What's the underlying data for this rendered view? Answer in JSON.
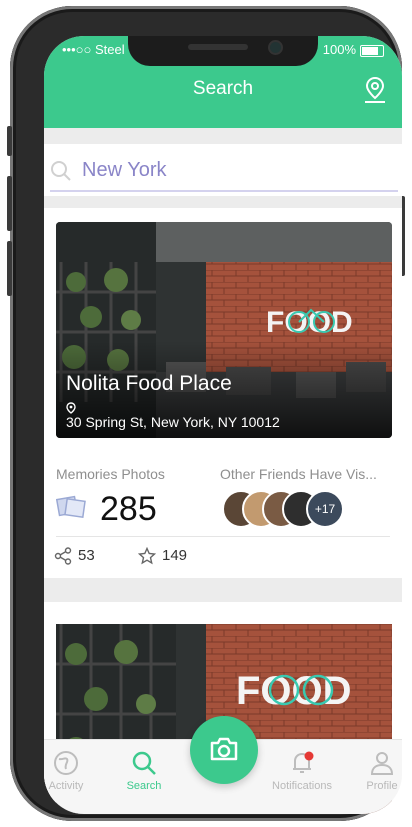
{
  "status": {
    "carrier": "Steel",
    "battery": "100%"
  },
  "header": {
    "title": "Search"
  },
  "search": {
    "value": "New York",
    "placeholder": ""
  },
  "place": {
    "name": "Nolita Food Place",
    "address": "30 Spring St, New York, NY 10012",
    "sign": "FOOD",
    "memories_label": "Memories Photos",
    "memories_count": "285",
    "friends_label": "Other Friends Have Vis...",
    "friends_more": "+17",
    "shares": "53",
    "stars": "149"
  },
  "tabs": [
    {
      "label": "Activity",
      "icon": "globe-icon"
    },
    {
      "label": "Search",
      "icon": "search-icon"
    },
    {
      "label": "Notifications",
      "icon": "bell-icon"
    },
    {
      "label": "Profile",
      "icon": "person-icon"
    }
  ],
  "colors": {
    "accent": "#3cc98d",
    "search_text": "#8a85c8",
    "notification_dot": "#e53935"
  }
}
